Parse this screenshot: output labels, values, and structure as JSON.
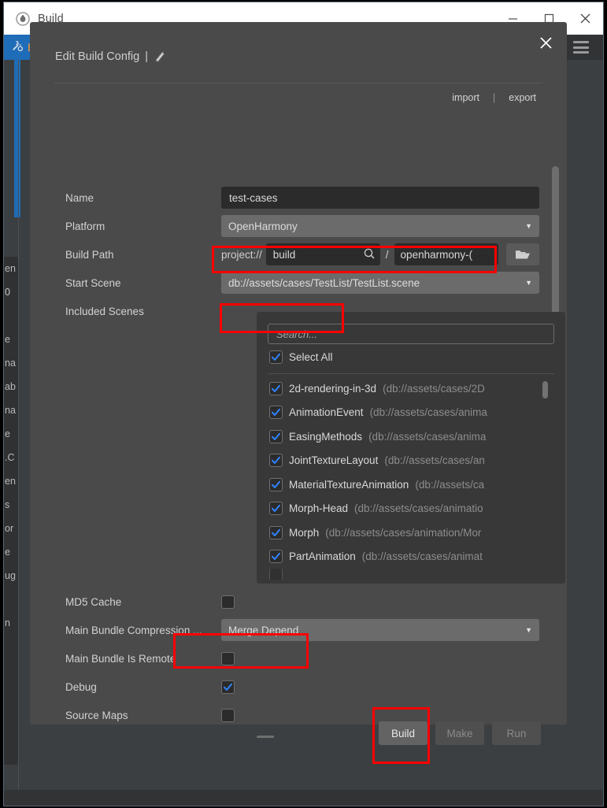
{
  "window": {
    "title": "Build",
    "app_icon": "droplet-icon",
    "controls": {
      "minimize": "minimize-icon",
      "maximize": "maximize-icon",
      "close": "close-icon"
    }
  },
  "tabbar": {
    "tab_label": "Build",
    "tab_icon": "hammer-wrench-icon",
    "menu_icon": "hamburger-menu-icon"
  },
  "dialog": {
    "title": "Edit Build Config",
    "title_separator": "|",
    "doc_icon": "document-icon",
    "close_icon": "close-icon",
    "import_label": "import",
    "export_label": "export",
    "links_separator": "|"
  },
  "form": {
    "name": {
      "label": "Name",
      "value": "test-cases"
    },
    "platform": {
      "label": "Platform",
      "value": "OpenHarmony",
      "caret": "▼"
    },
    "build_path": {
      "label": "Build Path",
      "prefix": "project://",
      "value": "build",
      "search_icon": "magnifier-icon",
      "slash": "/",
      "value2": "openharmony-(",
      "folder_icon": "folder-open-icon"
    },
    "start_scene": {
      "label": "Start Scene",
      "value": "db://assets/cases/TestList/TestList.scene",
      "caret": "▼"
    },
    "included_scenes": {
      "label": "Included Scenes"
    }
  },
  "scenes": {
    "search_placeholder": "Search...",
    "select_all_label": "Select All",
    "select_all_checked": true,
    "items": [
      {
        "name": "2d-rendering-in-3d",
        "path": "(db://assets/cases/2D",
        "checked": true
      },
      {
        "name": "AnimationEvent",
        "path": "(db://assets/cases/anima",
        "checked": true
      },
      {
        "name": "EasingMethods",
        "path": "(db://assets/cases/anima",
        "checked": true
      },
      {
        "name": "JointTextureLayout",
        "path": "(db://assets/cases/an",
        "checked": true
      },
      {
        "name": "MaterialTextureAnimation",
        "path": "(db://assets/ca",
        "checked": true
      },
      {
        "name": "Morph-Head",
        "path": "(db://assets/cases/animatio",
        "checked": true
      },
      {
        "name": "Morph",
        "path": "(db://assets/cases/animation/Mor",
        "checked": true
      },
      {
        "name": "PartAnimation",
        "path": "(db://assets/cases/animat",
        "checked": true
      }
    ]
  },
  "options": {
    "md5_cache": {
      "label": "MD5 Cache",
      "checked": false
    },
    "main_bundle_compression": {
      "label": "Main Bundle Compression ...",
      "value": "Merge Depend",
      "caret": "▼"
    },
    "main_bundle_is_remote": {
      "label": "Main Bundle Is Remote",
      "checked": false
    },
    "debug": {
      "label": "Debug",
      "checked": true
    },
    "source_maps": {
      "label": "Source Maps",
      "checked": false
    }
  },
  "actions": {
    "build": "Build",
    "make": "Make",
    "run": "Run"
  },
  "background": {
    "fragments": [
      "en",
      "0",
      "",
      "e",
      "na",
      "ab",
      "na",
      "e",
      ".C",
      "en",
      "s",
      "or",
      "e",
      "ug",
      "",
      "n"
    ],
    "status_text": ""
  },
  "colors": {
    "accent_blue": "#1f6cb8",
    "tab_text_orange": "#ff9d2e",
    "annotation_red": "#ff0000",
    "checkbox_blue": "#2f81f7",
    "dialog_bg": "#4a4a4a",
    "input_bg": "#2b2b2b",
    "dropdown_bg": "#6b6b6b"
  },
  "annotations": [
    {
      "name": "start-scene-highlight"
    },
    {
      "name": "select-all-highlight"
    },
    {
      "name": "debug-highlight"
    },
    {
      "name": "build-button-highlight"
    }
  ]
}
